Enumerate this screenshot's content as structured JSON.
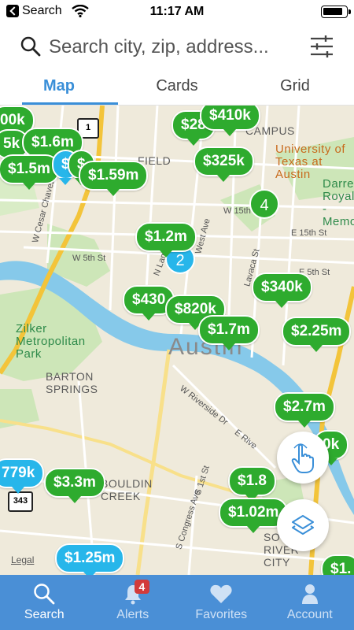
{
  "status": {
    "carrier": "Search",
    "time": "11:17 AM"
  },
  "search": {
    "placeholder": "Search city, zip, address..."
  },
  "tabs": [
    {
      "label": "Map",
      "active": true
    },
    {
      "label": "Cards",
      "active": false
    },
    {
      "label": "Grid",
      "active": false
    }
  ],
  "map": {
    "city_label": "Austin",
    "labels": {
      "ut": "University of Texas at Austin",
      "campus": "CAMPUS",
      "field": "FIELD",
      "zilker": "Zilker Metropolitan Park",
      "barton": "BARTON SPRINGS",
      "bouldin": "BOULDIN CREEK",
      "river_city": "SOUTH RIVER CITY",
      "darrell": "Darrell Royal - Memorial"
    },
    "streets": {
      "w15": "W 15th St",
      "e15": "E 15th St",
      "w5": "W 5th St",
      "e5": "E 5th St",
      "lavaca": "Lavaca St",
      "westave": "West Ave",
      "cesar": "W Cesar Chavez",
      "riverside": "W Riverside Dr",
      "eriver": "E Rive",
      "congress": "S Congress Ave",
      "firstst": "S 1st St",
      "lamar": "N Lamar"
    },
    "highway_shields": [
      "1",
      "343"
    ],
    "legal": "Legal",
    "pins": [
      {
        "label": "00k",
        "color": "green"
      },
      {
        "label": "5k",
        "color": "green"
      },
      {
        "label": "$1.6m",
        "color": "green"
      },
      {
        "label": "$1.5m",
        "color": "green"
      },
      {
        "label": "$",
        "color": "blue"
      },
      {
        "label": "$",
        "color": "green"
      },
      {
        "label": "$1.59m",
        "color": "green"
      },
      {
        "label": "$28",
        "color": "green"
      },
      {
        "label": "$410k",
        "color": "green"
      },
      {
        "label": "$325k",
        "color": "green"
      },
      {
        "label": "$1.2m",
        "color": "green"
      },
      {
        "label": "$430",
        "color": "green"
      },
      {
        "label": "$820k",
        "color": "green"
      },
      {
        "label": "$1.7m",
        "color": "green"
      },
      {
        "label": "$340k",
        "color": "green"
      },
      {
        "label": "$2.25m",
        "color": "green"
      },
      {
        "label": "$2.7m",
        "color": "green"
      },
      {
        "label": "0k",
        "color": "green"
      },
      {
        "label": "779k",
        "color": "blue"
      },
      {
        "label": "$3.3m",
        "color": "green"
      },
      {
        "label": "$1.8",
        "color": "green"
      },
      {
        "label": "$1.02m",
        "color": "green"
      },
      {
        "label": "$1.25m",
        "color": "blue"
      },
      {
        "label": "$1.",
        "color": "green"
      }
    ],
    "clusters": [
      {
        "label": "4",
        "color": "green"
      },
      {
        "label": "2",
        "color": "blue"
      }
    ]
  },
  "nav": [
    {
      "label": "Search",
      "icon": "search-icon",
      "active": true
    },
    {
      "label": "Alerts",
      "icon": "bell-icon",
      "badge": "4",
      "active": false
    },
    {
      "label": "Favorites",
      "icon": "heart-icon",
      "active": false
    },
    {
      "label": "Account",
      "icon": "person-icon",
      "active": false
    }
  ]
}
